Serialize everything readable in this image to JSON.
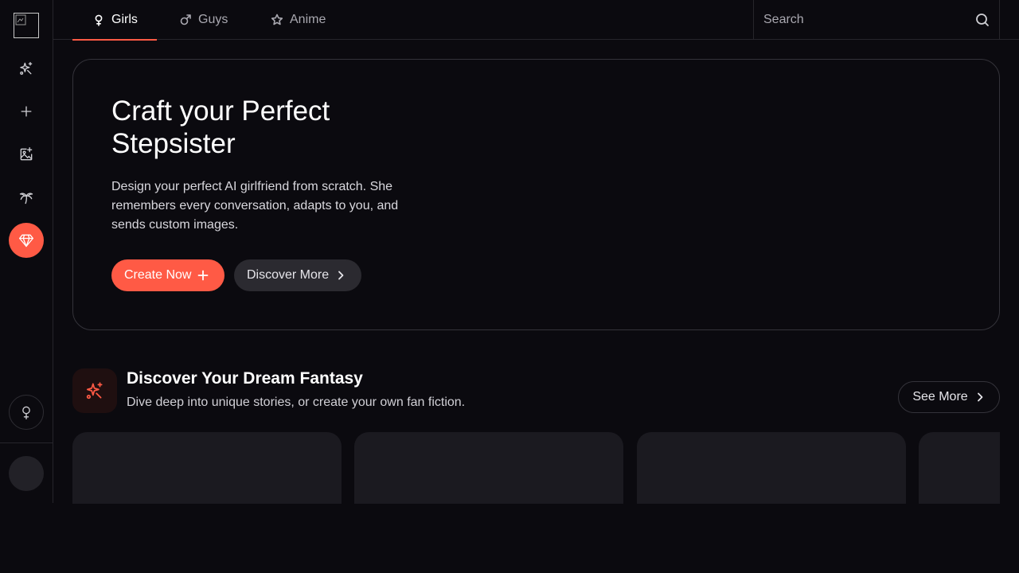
{
  "sidebar": {
    "items": [
      {
        "name": "discover",
        "icon": "sparkles-icon"
      },
      {
        "name": "create",
        "icon": "plus-icon"
      },
      {
        "name": "generate-image",
        "icon": "image-plus-icon"
      },
      {
        "name": "my-ai",
        "icon": "palm-tree-icon"
      },
      {
        "name": "premium",
        "icon": "gem-icon"
      }
    ],
    "gender_icon": "venus-icon"
  },
  "tabs": [
    {
      "label": "Girls",
      "icon": "venus-icon",
      "active": true
    },
    {
      "label": "Guys",
      "icon": "mars-icon",
      "active": false
    },
    {
      "label": "Anime",
      "icon": "star-icon",
      "active": false
    }
  ],
  "search": {
    "placeholder": "Search"
  },
  "hero": {
    "title": "Craft your Perfect Stepsister",
    "description": "Design your perfect AI girlfriend from scratch. She remembers every conversation, adapts to you, and sends custom images.",
    "primary_button": "Create Now",
    "secondary_button": "Discover More"
  },
  "section": {
    "title": "Discover Your Dream Fantasy",
    "subtitle": "Dive deep into unique stories, or create your own fan fiction.",
    "see_more": "See More"
  },
  "colors": {
    "accent": "#ff5a45",
    "background": "#0b0a0f",
    "card": "#1b1a20"
  }
}
